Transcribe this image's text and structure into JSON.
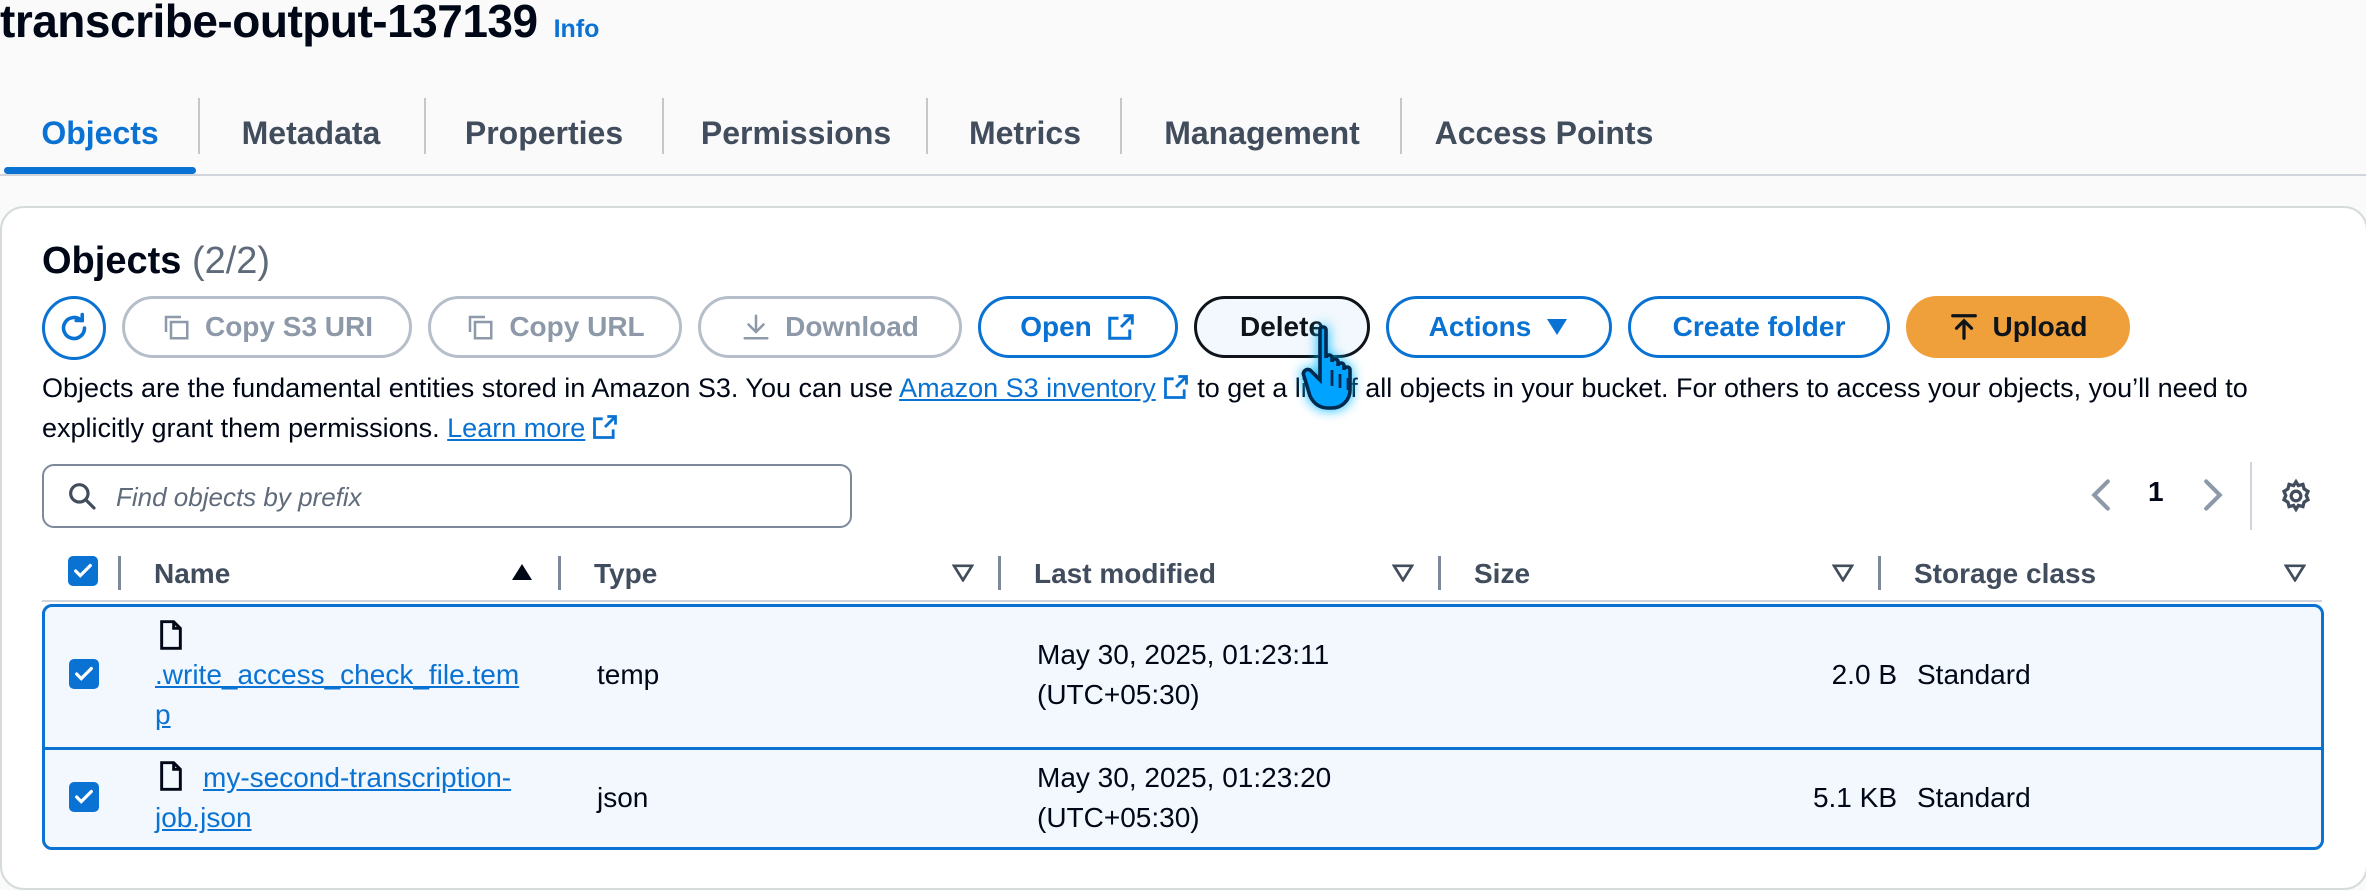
{
  "bucket": {
    "title": "transcribe-output-137139",
    "info_label": "Info"
  },
  "tabs": [
    {
      "label": "Objects",
      "active": true
    },
    {
      "label": "Metadata"
    },
    {
      "label": "Properties"
    },
    {
      "label": "Permissions"
    },
    {
      "label": "Metrics"
    },
    {
      "label": "Management"
    },
    {
      "label": "Access Points"
    }
  ],
  "objects": {
    "heading": "Objects",
    "count": "(2/2)"
  },
  "toolbar": {
    "copy_s3_uri": "Copy S3 URI",
    "copy_url": "Copy URL",
    "download": "Download",
    "open": "Open",
    "delete": "Delete",
    "actions": "Actions",
    "create_folder": "Create folder",
    "upload": "Upload"
  },
  "description": {
    "text1": "Objects are the fundamental entities stored in Amazon S3. You can use ",
    "inventory_link": "Amazon S3 inventory",
    "text2": " to get a list of all objects in your bucket. For others to access your objects, you’ll need to explicitly grant them permissions. ",
    "learn_more": "Learn more"
  },
  "search": {
    "placeholder": "Find objects by prefix"
  },
  "pagination": {
    "current_page": "1"
  },
  "table": {
    "columns": [
      "Name",
      "Type",
      "Last modified",
      "Size",
      "Storage class"
    ],
    "rows": [
      {
        "name_line1": ".write_access_check_file.tem",
        "name_line2": "p",
        "type": "temp",
        "modified_line1": "May 30, 2025, 01:23:11",
        "modified_line2": "(UTC+05:30)",
        "size": "2.0 B",
        "storage_class": "Standard",
        "selected": true
      },
      {
        "name_line1": "my-second-transcription-",
        "name_line2": "job.json",
        "type": "json",
        "modified_line1": "May 30, 2025, 01:23:20",
        "modified_line2": "(UTC+05:30)",
        "size": "5.1 KB",
        "storage_class": "Standard",
        "selected": true
      }
    ]
  },
  "colors": {
    "accent": "#0972d3",
    "upload": "#f0a03a",
    "selected_row_bg": "#f2f8fd",
    "cursor": "#00b7ff"
  },
  "icons": [
    "refresh-icon",
    "copy-icon",
    "download-icon",
    "external-link-icon",
    "caret-down-icon",
    "upload-arrow-icon",
    "search-icon",
    "chevron-left-icon",
    "chevron-right-icon",
    "gear-icon",
    "sort-ascending-icon",
    "sort-icon",
    "file-icon",
    "checkbox-checked-icon",
    "hand-pointer-icon"
  ]
}
